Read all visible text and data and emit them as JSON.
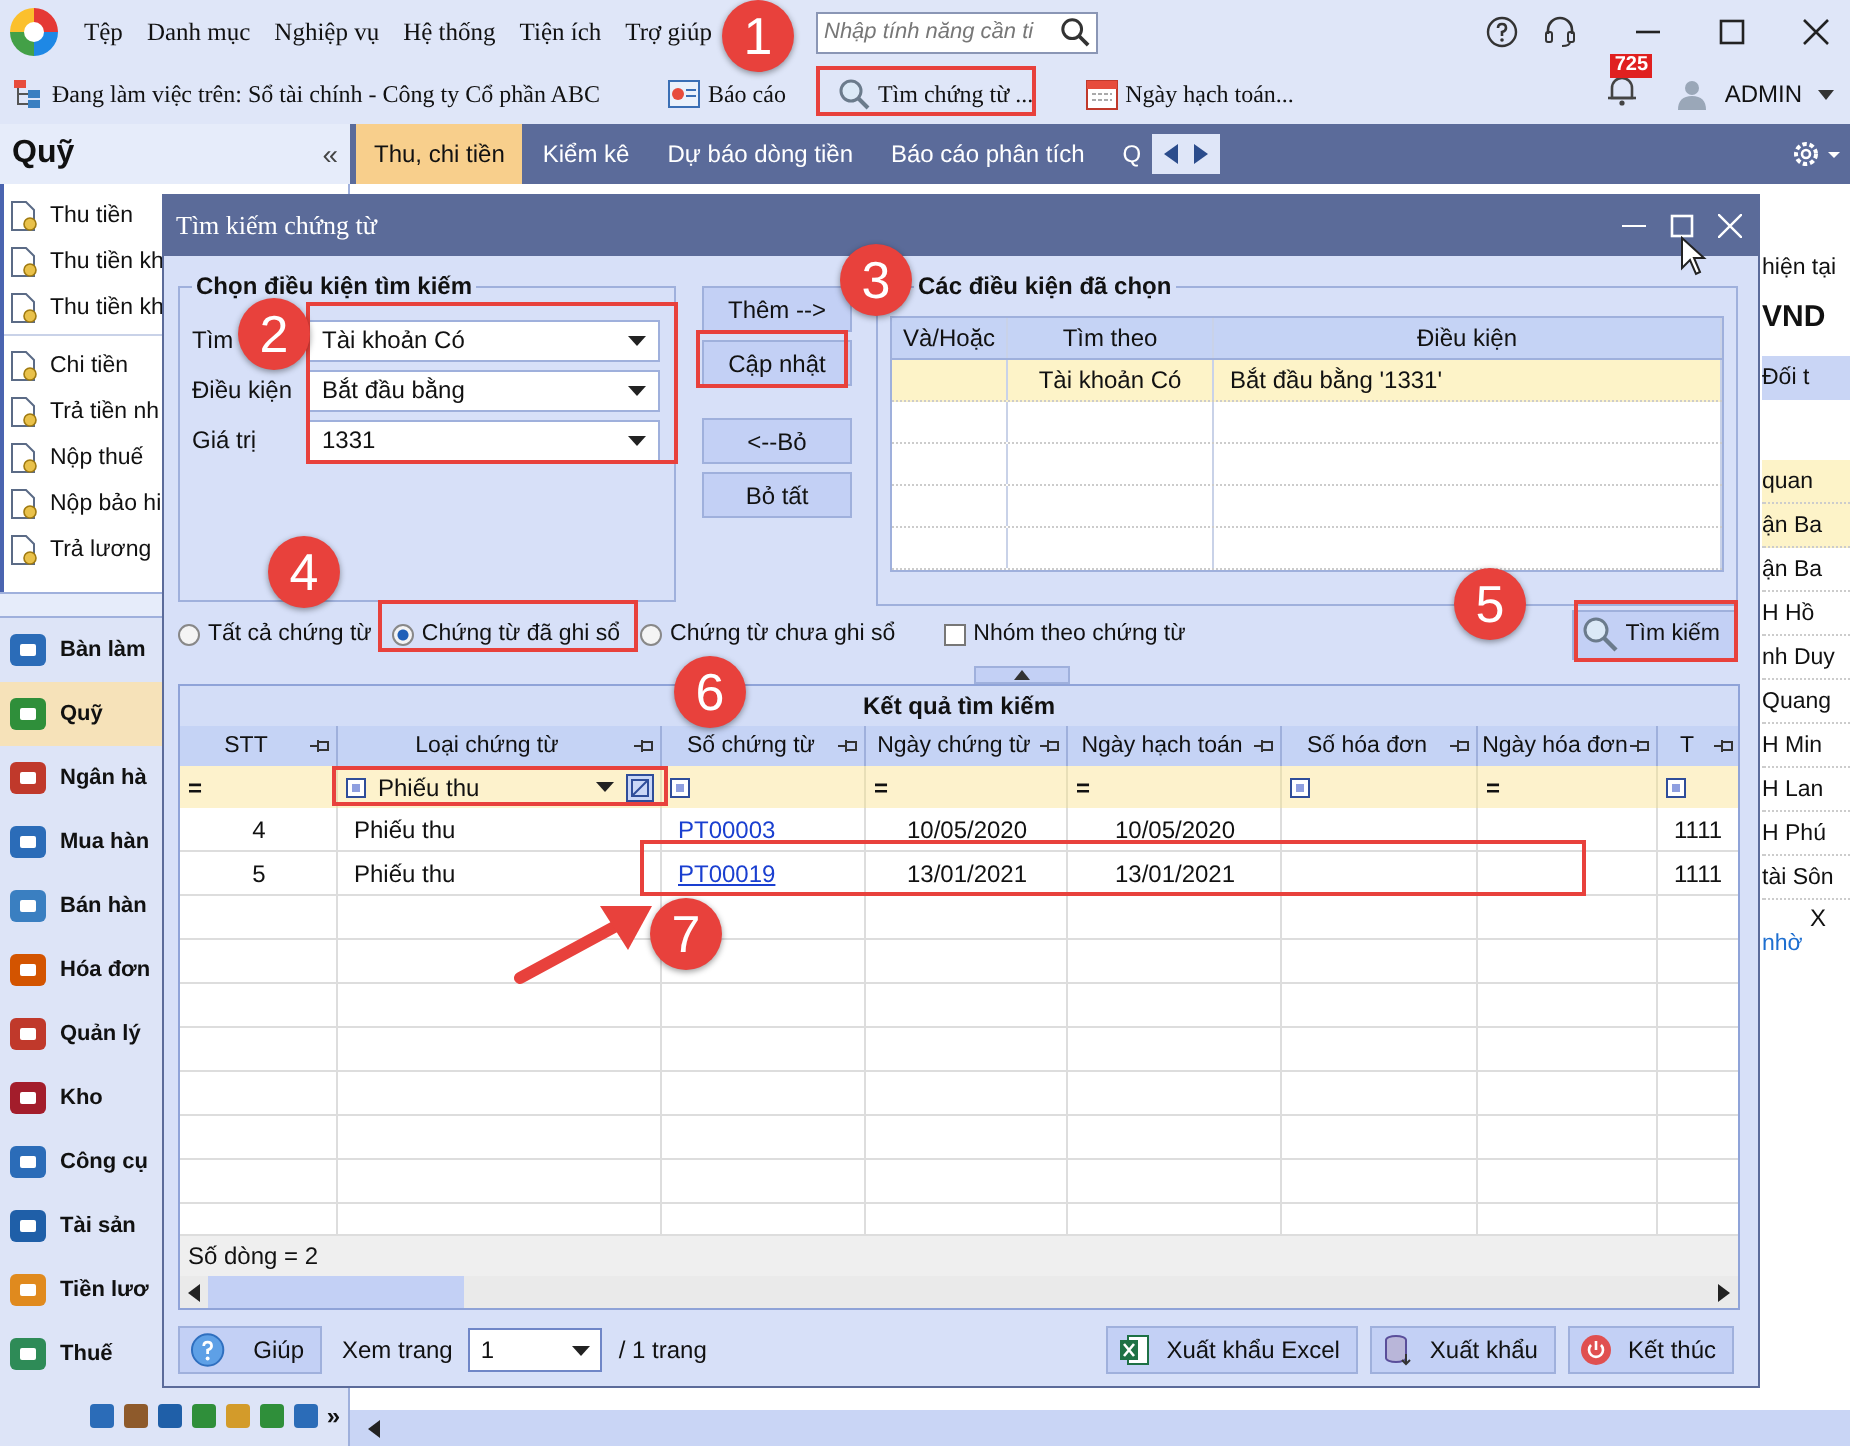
{
  "menubar": {
    "items": [
      "Tệp",
      "Danh mục",
      "Nghiệp vụ",
      "Hệ thống",
      "Tiện ích",
      "Trợ giúp"
    ],
    "search": {
      "placeholder": "Nhập tính năng cần ti"
    }
  },
  "toolbar": {
    "workspace": "Đang làm việc trên: Sổ tài chính - Công ty Cổ phần ABC",
    "buttons": [
      {
        "label": "Báo cáo",
        "kind": "report"
      },
      {
        "label": "Tìm chứng từ ...",
        "kind": "search"
      },
      {
        "label": "Ngày hạch toán...",
        "kind": "calendar"
      }
    ],
    "notification_count": "725",
    "user": "ADMIN"
  },
  "sidebar": {
    "title": "Quỹ",
    "collapse": "«",
    "groups": [
      [
        "Thu tiền",
        "Thu tiền kh",
        "Thu tiền kh"
      ],
      [
        "Chi tiền",
        "Trả tiền nh",
        "Nộp thuế",
        "Nộp bảo hi",
        "Trả lương"
      ]
    ],
    "modules": [
      {
        "label": "Bàn làm",
        "selected": false
      },
      {
        "label": "Quỹ",
        "selected": true
      },
      {
        "label": "Ngân hà",
        "selected": false
      },
      {
        "label": "Mua hàn",
        "selected": false
      },
      {
        "label": "Bán hàn",
        "selected": false
      },
      {
        "label": "Hóa đơn",
        "selected": false
      },
      {
        "label": "Quản lý",
        "selected": false
      },
      {
        "label": "Kho",
        "selected": false
      },
      {
        "label": "Công cụ",
        "selected": false
      },
      {
        "label": "Tài sản",
        "selected": false
      },
      {
        "label": "Tiền lươ",
        "selected": false
      },
      {
        "label": "Thuế",
        "selected": false
      }
    ],
    "more": "»"
  },
  "tabs": [
    {
      "label": "Thu, chi tiền",
      "selected": true
    },
    {
      "label": "Kiểm kê",
      "selected": false
    },
    {
      "label": "Dự báo dòng tiền",
      "selected": false
    },
    {
      "label": "Báo cáo phân tích",
      "selected": false
    },
    {
      "label": "Q",
      "selected": false
    }
  ],
  "background_panel": {
    "items": [
      {
        "text": "hiện tại",
        "kind": "label"
      },
      {
        "text": "VND",
        "kind": "total"
      },
      {
        "text": "Đối t",
        "kind": "header"
      },
      {
        "text": "quan",
        "kind": "highlight"
      },
      {
        "text": "ận Ba",
        "kind": "highlight"
      },
      {
        "text": "ận Ba",
        "kind": "cell"
      },
      {
        "text": "H Hồ",
        "kind": "cell"
      },
      {
        "text": "nh Duy",
        "kind": "cell"
      },
      {
        "text": "Quang",
        "kind": "cell"
      },
      {
        "text": "H Min",
        "kind": "cell"
      },
      {
        "text": "H Lan",
        "kind": "cell"
      },
      {
        "text": "H Phú",
        "kind": "cell"
      },
      {
        "text": "tài Sôn",
        "kind": "cell"
      },
      {
        "text": "X",
        "kind": "close"
      },
      {
        "text": "nhờ",
        "kind": "link"
      }
    ]
  },
  "dialog": {
    "title": "Tìm kiếm chứng từ",
    "criteria": {
      "title": "Chọn điều kiện tìm kiếm",
      "fields": [
        {
          "label": "Tìm",
          "value": "Tài khoản Có"
        },
        {
          "label": "Điều kiện",
          "value": "Bắt đầu bằng"
        },
        {
          "label": "Giá trị",
          "value": "1331"
        }
      ]
    },
    "actions": [
      "Thêm -->",
      "Cập nhật",
      "<--Bỏ",
      "Bỏ tất"
    ],
    "chosen": {
      "title": "Các điều kiện đã chọn",
      "columns": [
        "Và/Hoặc",
        "Tìm theo",
        "Điều kiện"
      ],
      "rows": [
        {
          "field": "Tài khoản Có",
          "condition": "Bắt đầu bằng '1331'",
          "selected": true
        }
      ]
    },
    "filters": [
      {
        "label": "Tất cả chứng từ",
        "selected": false
      },
      {
        "label": "Chứng từ đã ghi sổ",
        "selected": true
      },
      {
        "label": "Chứng từ chưa ghi sổ",
        "selected": false
      }
    ],
    "group_by": {
      "label": "Nhóm theo chứng từ",
      "checked": false
    },
    "search_button": "Tìm kiếm",
    "results": {
      "title": "Kết quả tìm kiếm",
      "columns": [
        "STT",
        "Loại chứng từ",
        "Số chứng từ",
        "Ngày chứng từ",
        "Ngày hạch toán",
        "Số hóa đơn",
        "Ngày hóa đơn",
        "T"
      ],
      "filter_row": [
        {
          "kind": "operator",
          "text": "="
        },
        {
          "kind": "dropdown",
          "text": "Phiếu thu"
        },
        {
          "kind": "toggle"
        },
        {
          "kind": "operator",
          "text": "="
        },
        {
          "kind": "operator",
          "text": "="
        },
        {
          "kind": "toggle"
        },
        {
          "kind": "operator",
          "text": "="
        },
        {
          "kind": "toggle"
        }
      ],
      "rows": [
        {
          "stt": "4",
          "type": "Phiếu thu",
          "number": "PT00003",
          "date": "10/05/2020",
          "posting_date": "10/05/2020",
          "account": "1111"
        },
        {
          "stt": "5",
          "type": "Phiếu thu",
          "number": "PT00019",
          "date": "13/01/2021",
          "posting_date": "13/01/2021",
          "account": "1111"
        }
      ],
      "row_count": "Số dòng = 2"
    },
    "footer": {
      "help": "Giúp",
      "page_label": "Xem trang",
      "page": "1",
      "page_total": "/ 1 trang",
      "buttons": [
        {
          "label": "Xuất khẩu Excel",
          "kind": "excel"
        },
        {
          "label": "Xuất khẩu",
          "kind": "export"
        },
        {
          "label": "Kết thúc",
          "kind": "close"
        }
      ]
    }
  },
  "annotations": [
    "1",
    "2",
    "3",
    "4",
    "5",
    "6",
    "7"
  ]
}
